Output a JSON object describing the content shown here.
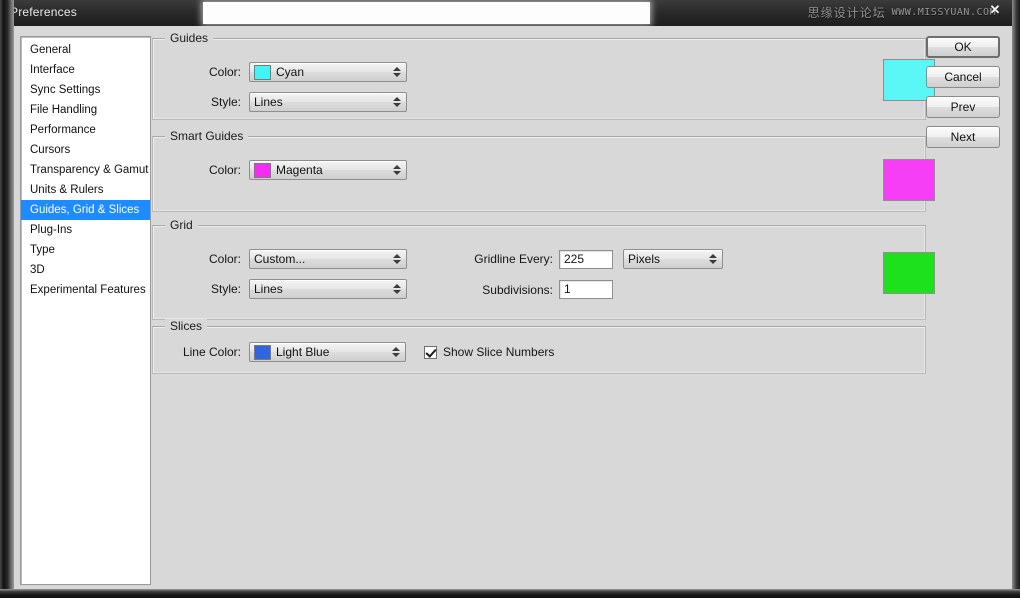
{
  "window": {
    "title": "Preferences",
    "close_icon": "close-icon",
    "watermark_cn": "思缘设计论坛",
    "watermark_url": "WWW.MISSYUAN.COM"
  },
  "sidebar": {
    "items": [
      {
        "label": "General",
        "selected": false
      },
      {
        "label": "Interface",
        "selected": false
      },
      {
        "label": "Sync Settings",
        "selected": false
      },
      {
        "label": "File Handling",
        "selected": false
      },
      {
        "label": "Performance",
        "selected": false
      },
      {
        "label": "Cursors",
        "selected": false
      },
      {
        "label": "Transparency & Gamut",
        "selected": false
      },
      {
        "label": "Units & Rulers",
        "selected": false
      },
      {
        "label": "Guides, Grid & Slices",
        "selected": true
      },
      {
        "label": "Plug-Ins",
        "selected": false
      },
      {
        "label": "Type",
        "selected": false
      },
      {
        "label": "3D",
        "selected": false
      },
      {
        "label": "Experimental Features",
        "selected": false
      }
    ],
    "selected_highlight_color": "#1e8cff"
  },
  "guides": {
    "group_title": "Guides",
    "color_label": "Color:",
    "color_value": "Cyan",
    "color_hex": "#42f4f4",
    "style_label": "Style:",
    "style_value": "Lines",
    "preview_hex": "#5bf6f6"
  },
  "smart_guides": {
    "group_title": "Smart Guides",
    "color_label": "Color:",
    "color_value": "Magenta",
    "color_hex": "#f32df3",
    "preview_hex": "#f73ef7"
  },
  "grid": {
    "group_title": "Grid",
    "color_label": "Color:",
    "color_value": "Custom...",
    "style_label": "Style:",
    "style_value": "Lines",
    "gridline_every_label": "Gridline Every:",
    "gridline_every_value": "225",
    "unit_value": "Pixels",
    "subdivisions_label": "Subdivisions:",
    "subdivisions_value": "1",
    "preview_hex": "#1ee11e"
  },
  "slices": {
    "group_title": "Slices",
    "line_color_label": "Line Color:",
    "line_color_value": "Light Blue",
    "line_color_hex": "#2f66dd",
    "show_slice_numbers_label": "Show Slice Numbers",
    "show_slice_numbers_checked": true
  },
  "buttons": {
    "ok": "OK",
    "cancel": "Cancel",
    "prev": "Prev",
    "next": "Next"
  }
}
